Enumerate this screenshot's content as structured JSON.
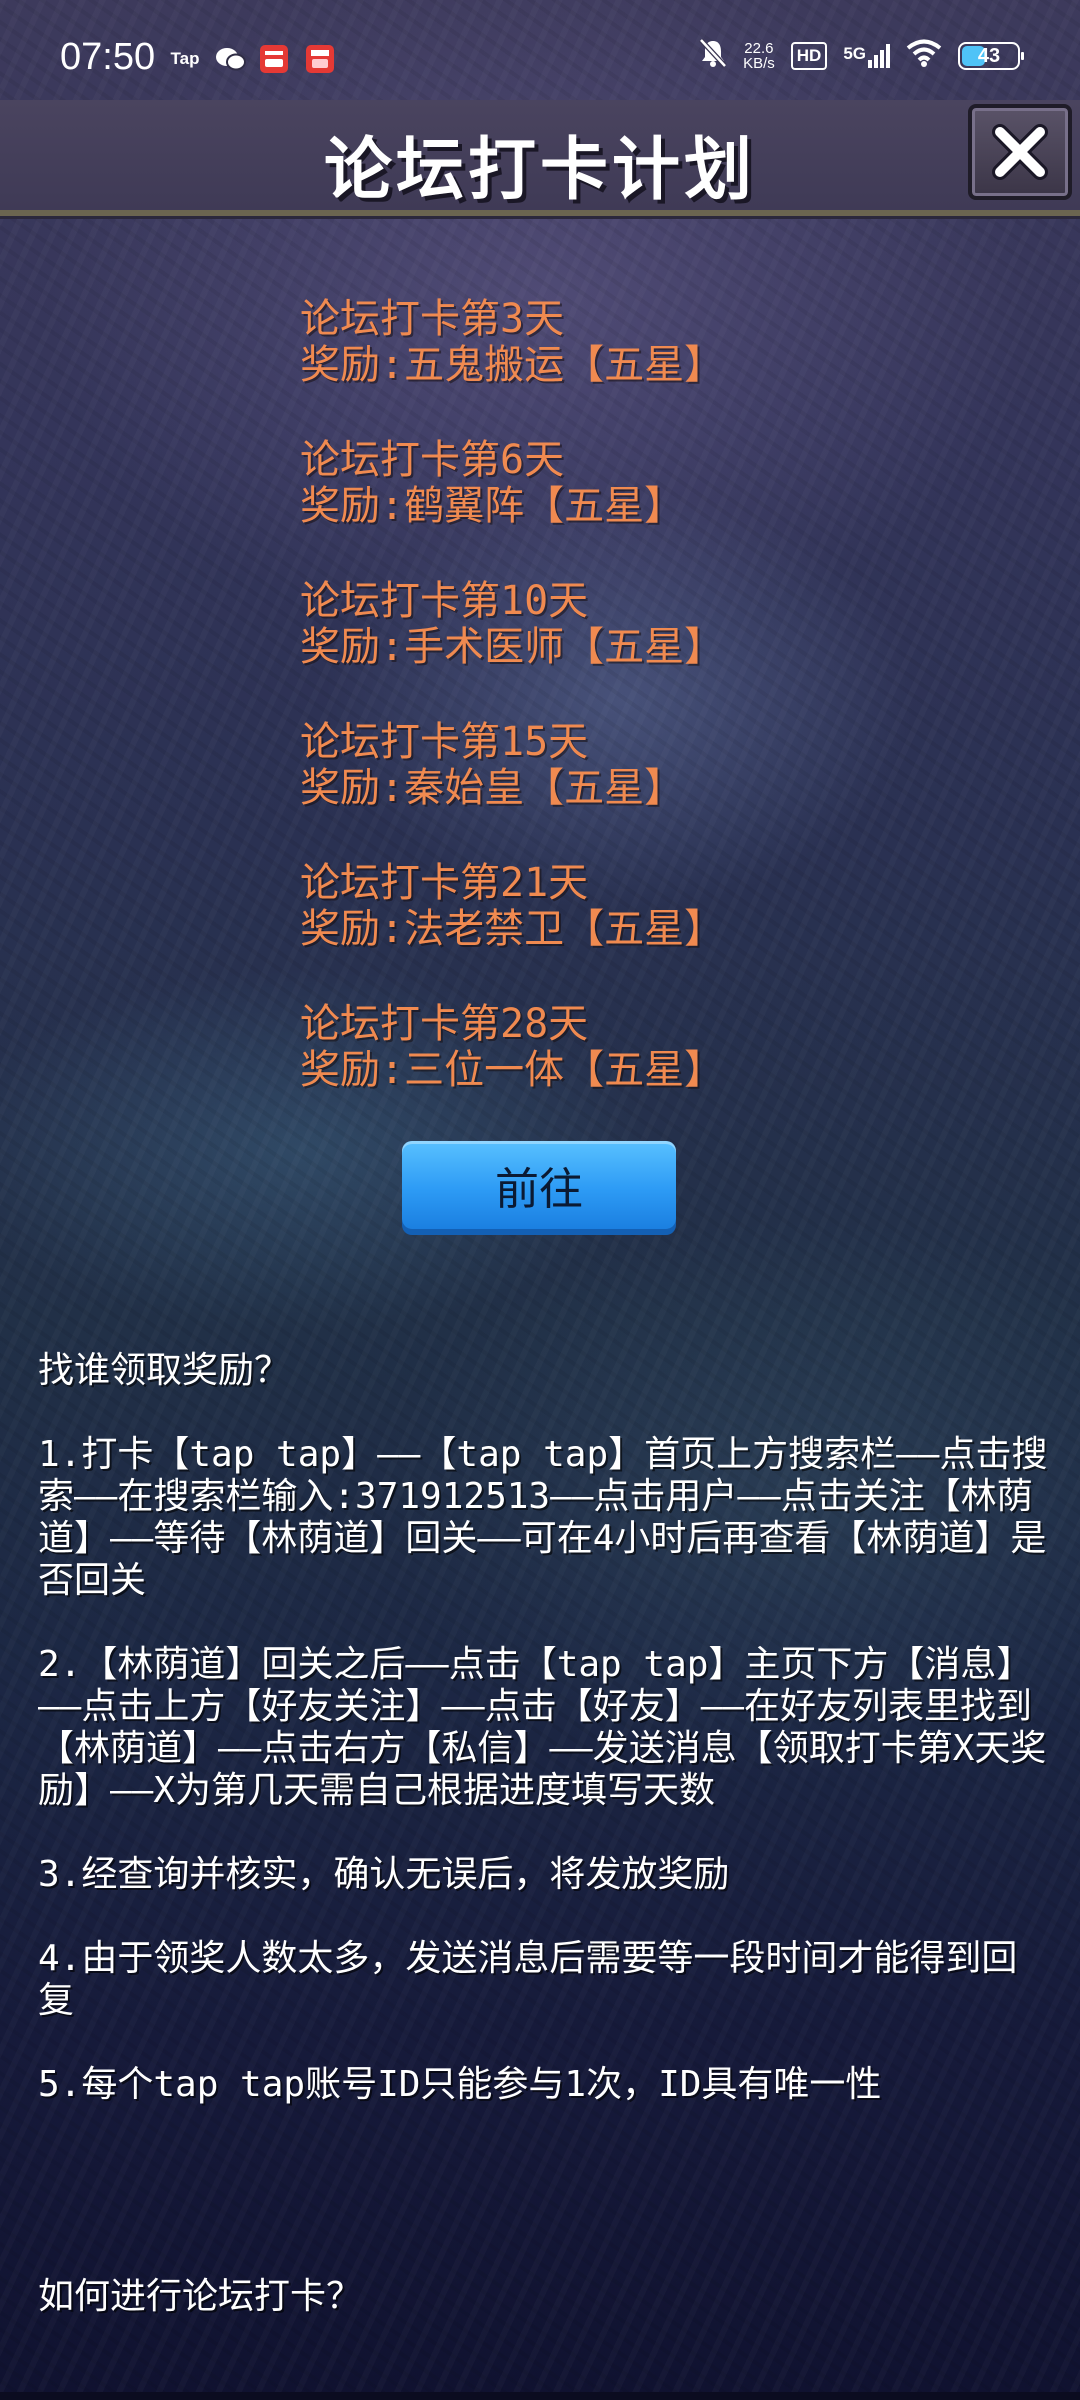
{
  "status_bar": {
    "time": "07:50",
    "app_icons": [
      "Tap",
      "wechat-icon",
      "app-icon-red-1",
      "app-icon-red-2"
    ],
    "tap_label": "Tap",
    "network_speed_value": "22.6",
    "network_speed_unit": "KB/s",
    "hd_label": "HD",
    "signal_label": "5G",
    "battery_level": "43",
    "battery_fraction": 0.43
  },
  "header": {
    "title": "论坛打卡计划"
  },
  "rewards": [
    {
      "day": "论坛打卡第3天",
      "reward": "奖励:五鬼搬运【五星】"
    },
    {
      "day": "论坛打卡第6天",
      "reward": "奖励:鹤翼阵【五星】"
    },
    {
      "day": "论坛打卡第10天",
      "reward": "奖励:手术医师【五星】"
    },
    {
      "day": "论坛打卡第15天",
      "reward": "奖励:秦始皇【五星】"
    },
    {
      "day": "论坛打卡第21天",
      "reward": "奖励:法老禁卫【五星】"
    },
    {
      "day": "论坛打卡第28天",
      "reward": "奖励:三位一体【五星】"
    }
  ],
  "go_button_label": "前往",
  "instructions": {
    "heading": "找谁领取奖励？",
    "steps": [
      "1.打卡【tap tap】——【tap tap】首页上方搜索栏——点击搜索——在搜索栏输入:371912513——点击用户——点击关注【林荫道】——等待【林荫道】回关——可在4小时后再查看【林荫道】是否回关",
      "2.【林荫道】回关之后——点击【tap tap】主页下方【消息】——点击上方【好友关注】——点击【好友】——在好友列表里找到【林荫道】——点击右方【私信】——发送消息【领取打卡第X天奖励】——X为第几天需自己根据进度填写天数",
      "3.经查询并核实，确认无误后，将发放奖励",
      "4.由于领奖人数太多，发送消息后需要等一段时间才能得到回复",
      "5.每个tap tap账号ID只能参与1次，ID具有唯一性"
    ],
    "heading2": "如何进行论坛打卡？"
  },
  "colors": {
    "reward_text": "#f08a50",
    "go_button": "#2d9bf5",
    "header_bg": "#4a445f"
  }
}
